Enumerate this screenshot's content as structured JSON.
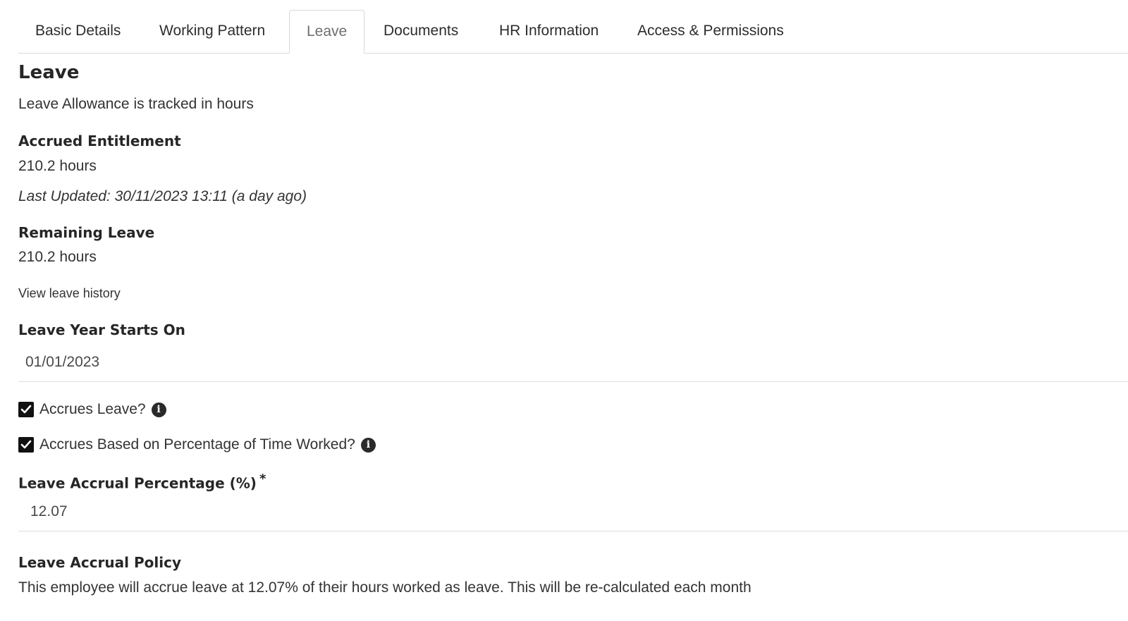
{
  "tabs": [
    {
      "label": "Basic Details",
      "active": false
    },
    {
      "label": "Working Pattern",
      "active": false
    },
    {
      "label": "Leave",
      "active": true
    },
    {
      "label": "Documents",
      "active": false
    },
    {
      "label": "HR Information",
      "active": false
    },
    {
      "label": "Access & Permissions",
      "active": false
    }
  ],
  "leave": {
    "title": "Leave",
    "allowance_note": "Leave Allowance is tracked in hours",
    "accrued": {
      "label": "Accrued Entitlement",
      "value": "210.2 hours",
      "last_updated": "Last Updated: 30/11/2023 13:11 (a day ago)"
    },
    "remaining": {
      "label": "Remaining Leave",
      "value": "210.2 hours"
    },
    "history_link": "View leave history",
    "year_start": {
      "label": "Leave Year Starts On",
      "value": "01/01/2023"
    },
    "accrues_leave": {
      "label": "Accrues Leave?",
      "checked": true,
      "info_icon": "info-icon"
    },
    "accrues_percentage": {
      "label": "Accrues Based on Percentage of Time Worked?",
      "checked": true,
      "info_icon": "info-icon"
    },
    "accrual_percentage": {
      "label": "Leave Accrual Percentage (%)",
      "required_marker": "*",
      "value": "12.07"
    },
    "policy": {
      "label": "Leave Accrual Policy",
      "text": "This employee will accrue leave at 12.07% of their hours worked as leave. This will be re-calculated each month"
    }
  },
  "colors": {
    "text": "#333333",
    "heading": "#262626",
    "border": "#d9d9d9",
    "checkbox": "#111111",
    "inactive_tab": "#6f6f6f"
  }
}
